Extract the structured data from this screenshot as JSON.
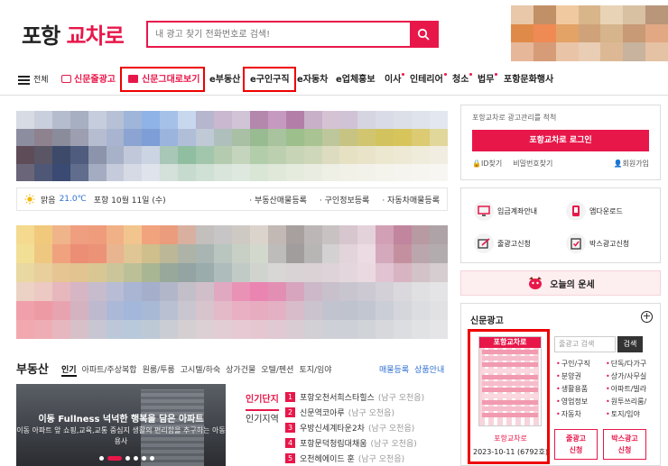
{
  "header": {
    "logo_part1": "포항",
    "logo_part2": "교차로",
    "search_placeholder": "내 광고 찾기 전화번호로 검색!"
  },
  "nav": {
    "menu_label": "전체",
    "items": [
      "신문줄광고",
      "신문그대로보기",
      "e부동산",
      "e구인구직",
      "e자동차",
      "e업체홍보",
      "이사",
      "인테리어",
      "청소",
      "법무",
      "포항문화행사"
    ]
  },
  "weather": {
    "condition": "맑음",
    "temp": "21.0℃",
    "location_date": "포항 10월 11일 (수)",
    "links": [
      "· 부동산매물등록",
      "· 구인정보등록",
      "· 자동차매물등록"
    ]
  },
  "real_estate": {
    "title": "부동산",
    "tabs": [
      "인기",
      "아파트/주상복합",
      "원룸/투룸",
      "고시텔/하숙",
      "상가건물",
      "오텔/펜션",
      "토지/임야"
    ],
    "links": [
      "매물등록",
      "상품안내"
    ],
    "banner_title": "이동 Fullness 넉넉한 행복을 담은 아파트",
    "banner_sub": "이동 아파트 앞 쇼핑,교육,교통 중심지 생활의 편리함을 추구하는 아동용사",
    "side_tabs": [
      "인기단지",
      "인기지역"
    ],
    "list": [
      {
        "num": "1",
        "name": "포항오천서희스타힐스",
        "loc": "(남구 오천읍)"
      },
      {
        "num": "2",
        "name": "신문역코아루",
        "loc": "(남구 오천읍)"
      },
      {
        "num": "3",
        "name": "우방신세계타운2차",
        "loc": "(남구 오천읍)"
      },
      {
        "num": "4",
        "name": "포항문덕청림대채움",
        "loc": "(남구 오천읍)"
      },
      {
        "num": "5",
        "name": "오천헤에이드 훈",
        "loc": "(남구 오천읍)"
      }
    ]
  },
  "login": {
    "tagline": "포항교차로 광고관리를 척척",
    "button": "포항교차로 로그인",
    "id_find": "ID찾기",
    "pw_find": "비밀번호찾기",
    "join": "회원가입"
  },
  "services": [
    "입금계좌안내",
    "앱다운로드",
    "줄광고신청",
    "박스광고신청"
  ],
  "fortune": "오늘의 운세",
  "newspaper": {
    "title": "신문광고",
    "paper_name": "포항교차로",
    "paper_date": "2023-10-11 (6792호)",
    "search_placeholder": "줄광고 검색",
    "search_button": "검색",
    "categories": [
      "구인/구직",
      "단독/다가구",
      "분양권",
      "상가/사무실",
      "생활용품",
      "아파트/빌라",
      "영업정보",
      "원투쓰리룸/",
      "자동차",
      "토지/임야"
    ],
    "btn1": [
      "줄광고",
      "신청"
    ],
    "btn2": [
      "박스광고",
      "신청"
    ]
  },
  "colors": {
    "brand": "#e8174a",
    "highlight_box": "#e00000"
  }
}
